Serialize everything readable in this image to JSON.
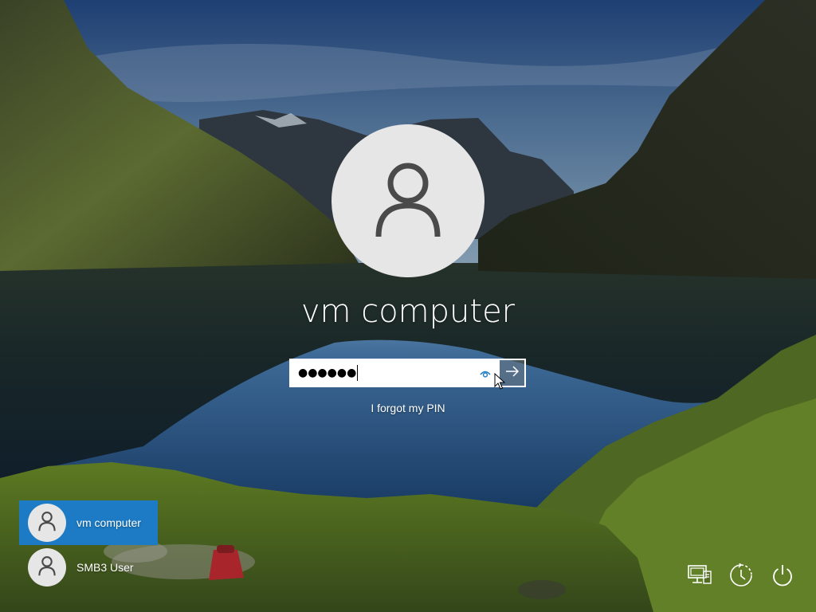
{
  "login": {
    "user_name": "vm computer",
    "pin_masked": "●●●●●●",
    "forgot_pin": "I forgot my PIN"
  },
  "user_list": [
    {
      "name": "vm computer",
      "selected": true
    },
    {
      "name": "SMB3 User",
      "selected": false
    }
  ],
  "icons": {
    "avatar": "user-silhouette-icon",
    "reveal": "eye-icon",
    "submit": "arrow-right-icon",
    "network": "network-icon",
    "ease_of_access": "ease-of-access-icon",
    "power": "power-icon"
  },
  "colors": {
    "selected_tile": "#1c7bc4",
    "avatar_bg": "#e6e6e6",
    "avatar_icon": "#4a4a4a",
    "reveal_icon": "#1c7bc4"
  }
}
